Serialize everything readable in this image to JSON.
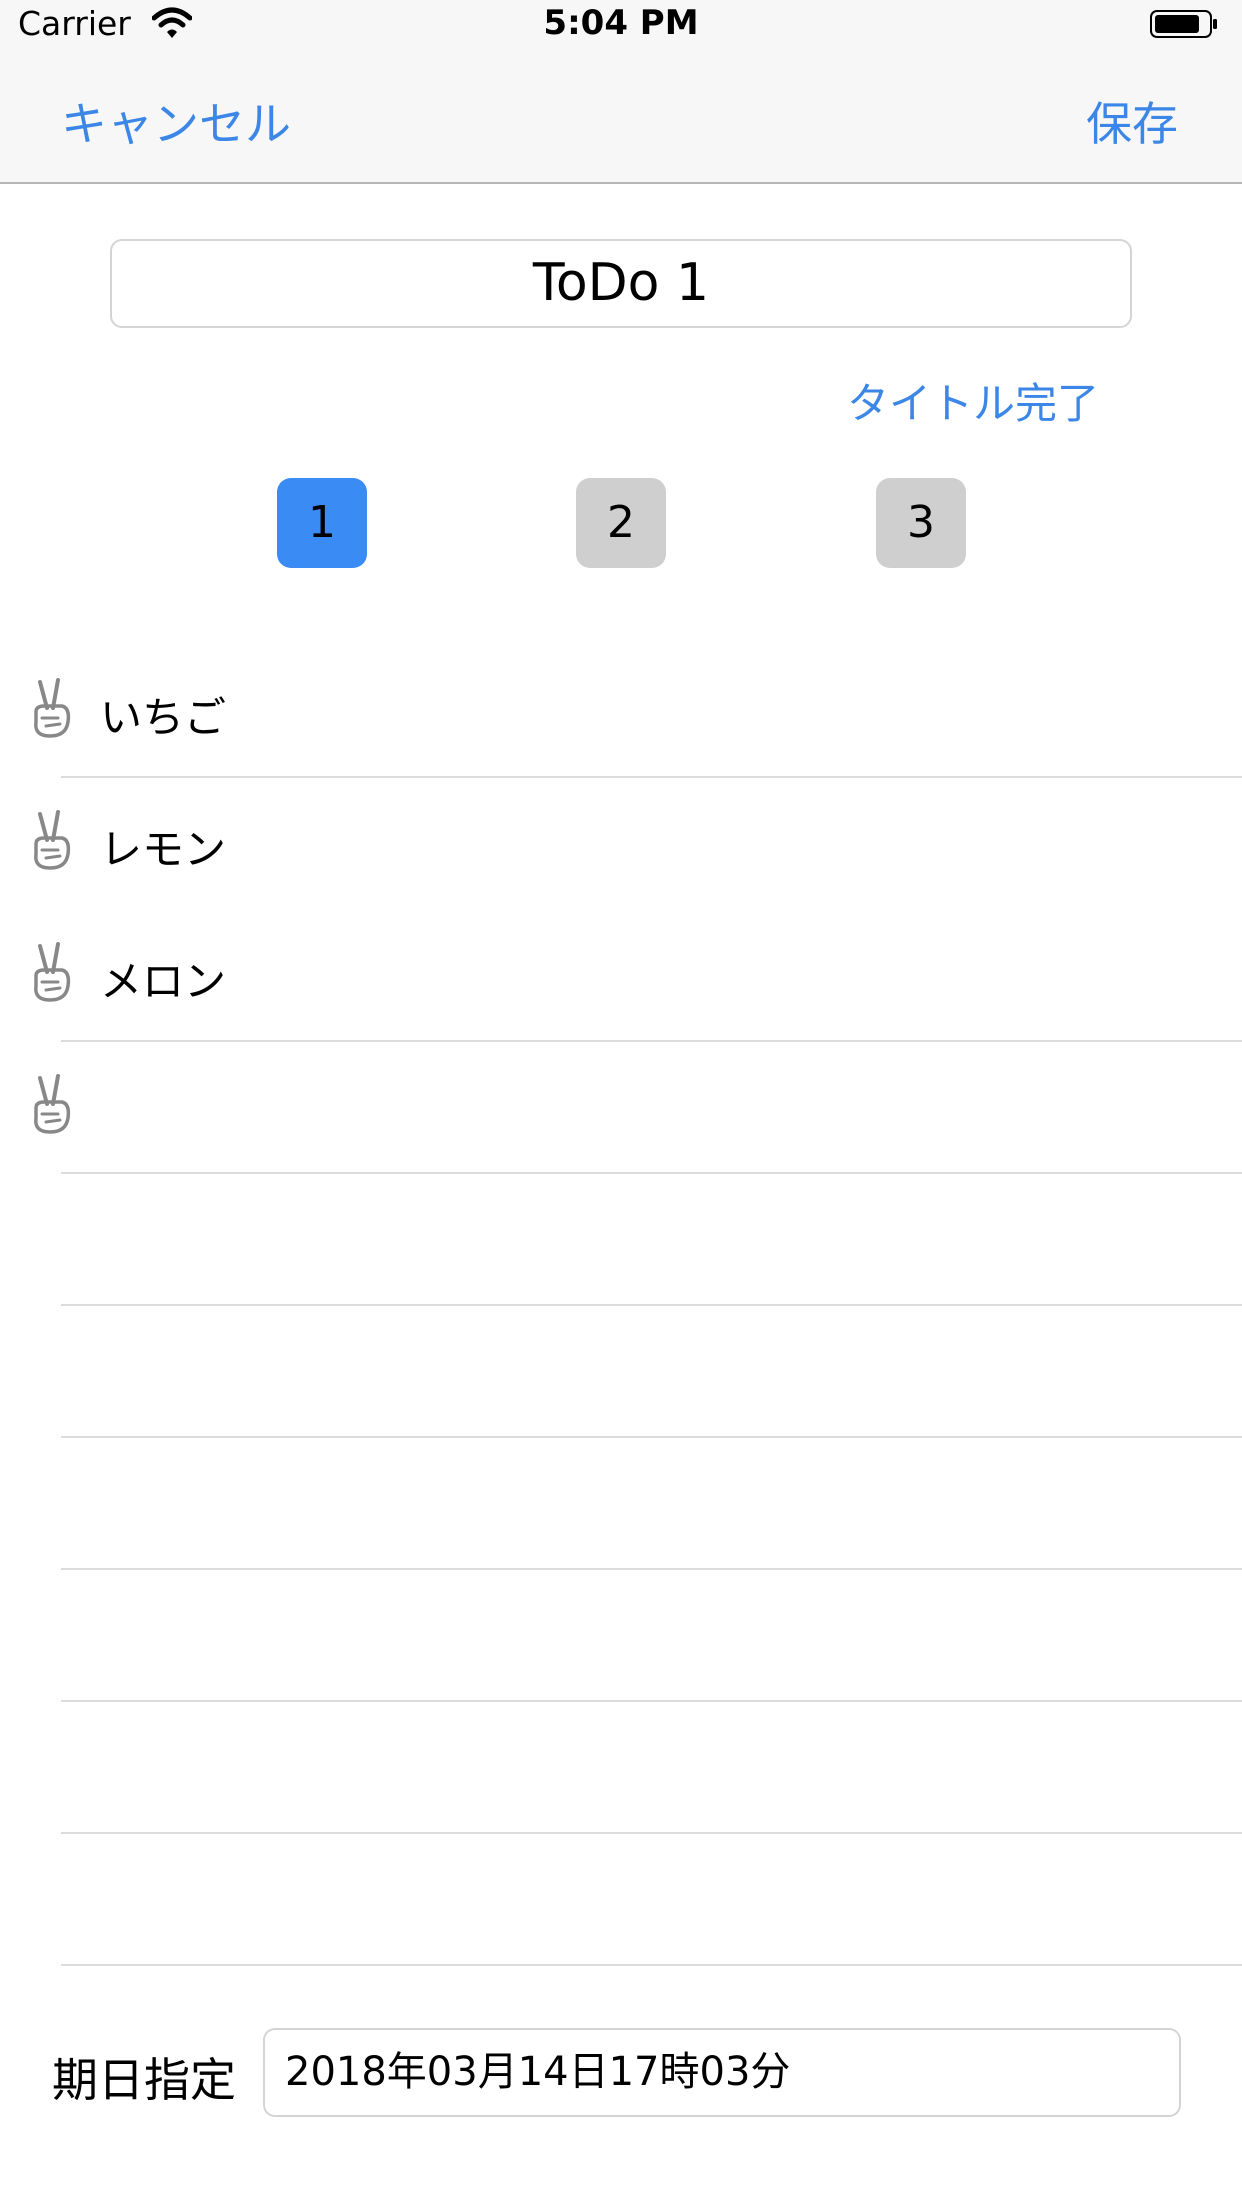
{
  "status_bar": {
    "carrier": "Carrier",
    "time": "5:04 PM"
  },
  "nav": {
    "cancel": "キャンセル",
    "save": "保存"
  },
  "title": {
    "value": "ToDo 1",
    "done": "タイトル完了"
  },
  "segments": [
    {
      "label": "1",
      "selected": true
    },
    {
      "label": "2",
      "selected": false
    },
    {
      "label": "3",
      "selected": false
    }
  ],
  "items": [
    {
      "label": "いちご",
      "icon": "peace-hand-icon"
    },
    {
      "label": "レモン",
      "icon": "peace-hand-icon"
    },
    {
      "label": "メロン",
      "icon": "peace-hand-icon"
    },
    {
      "label": "",
      "icon": "peace-hand-icon"
    }
  ],
  "due": {
    "label": "期日指定",
    "value": "2018年03月14日17時03分"
  },
  "colors": {
    "accent": "#3b86e6",
    "segment_active": "#3b8bf5",
    "segment_inactive": "#cfcfcf"
  }
}
